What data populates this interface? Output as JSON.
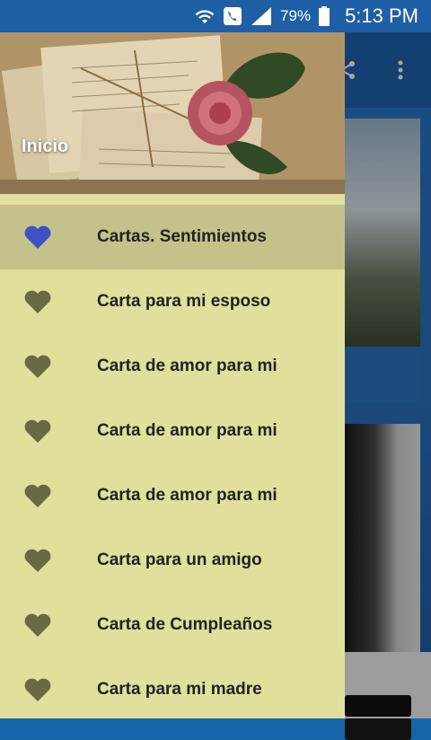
{
  "status_bar": {
    "battery": "79%",
    "time": "5:13 PM"
  },
  "drawer": {
    "header_title": "Inicio",
    "items": [
      {
        "label": "Cartas. Sentimientos",
        "active": true
      },
      {
        "label": "Carta para mi esposo",
        "active": false
      },
      {
        "label": "Carta de amor para mi",
        "active": false
      },
      {
        "label": "Carta de amor para mi",
        "active": false
      },
      {
        "label": "Carta de amor para mi",
        "active": false
      },
      {
        "label": "Carta para un amigo",
        "active": false
      },
      {
        "label": "Carta de Cumpleaños",
        "active": false
      },
      {
        "label": "Carta para mi madre",
        "active": false
      }
    ]
  },
  "colors": {
    "drawer_bg": "#e1df9c",
    "active_bg": "#c3c28a",
    "heart_active": "#3f51c4",
    "heart_inactive": "#6b6844",
    "status_bar": "#1f5fa6"
  },
  "icons": {
    "menu_item": "heart-icon",
    "toolbar": [
      "share-icon",
      "more-vert-icon"
    ]
  }
}
